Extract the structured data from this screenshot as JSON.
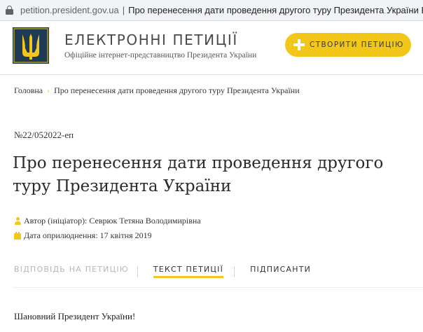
{
  "browser": {
    "url_domain": "petition.president.gov.ua",
    "url_separator": "|",
    "page_title": "Про перенесення дати проведення другого туру Президента України Електр"
  },
  "header": {
    "site_title": "ЕЛЕКТРОННІ ПЕТИЦІЇ",
    "site_subtitle": "Офіційне інтернет-представництво Президента України",
    "create_button_label": "СТВОРИТИ ПЕТИЦІЮ",
    "logo_icon": "tryzub-icon"
  },
  "breadcrumb": {
    "home": "Головна",
    "separator": "›",
    "current": "Про перенесення дати проведення другого туру Президента України"
  },
  "petition": {
    "number": "№22/052022-еп",
    "title": "Про перенесення дати проведення другого туру Президента України",
    "author_label": "Автор (ініціатор): Севрюк Тетяна Володимирівна",
    "date_label": "Дата оприлюднення: 17 квітня 2019",
    "author_icon": "person-icon",
    "date_icon": "calendar-icon"
  },
  "tabs": {
    "answer": "ВІДПОВІДЬ НА ПЕТИЦІЮ",
    "text": "ТЕКСТ ПЕТИЦІЇ",
    "signers": "ПІДПИСАНТИ",
    "active": "text"
  },
  "body": {
    "greeting": "Шановний Президент України!"
  },
  "colors": {
    "accent": "#f3c71a",
    "logo_background": "#1e3a55",
    "tab_inactive": "#b8b8b8",
    "text": "#333333"
  }
}
